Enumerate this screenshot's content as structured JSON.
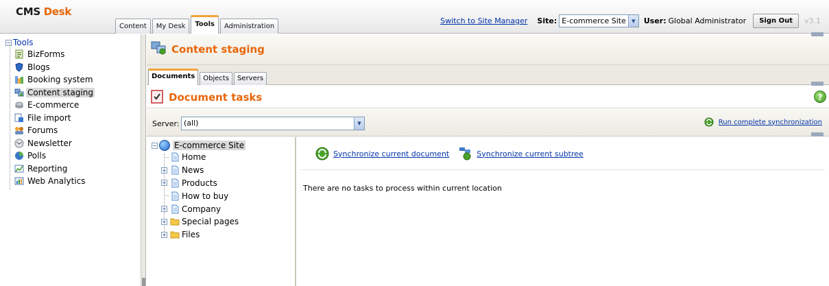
{
  "header": {
    "brand_cms": "CMS",
    "brand_desk": "Desk",
    "tabs": [
      {
        "label": "Content",
        "active": false
      },
      {
        "label": "My Desk",
        "active": false
      },
      {
        "label": "Tools",
        "active": true
      },
      {
        "label": "Administration",
        "active": false
      }
    ],
    "switch_link": "Switch to Site Manager",
    "site_label": "Site:",
    "site_value": "E-commerce Site",
    "user_label": "User:",
    "user_name": "Global Administrator",
    "sign_out": "Sign Out",
    "version": "v3.1"
  },
  "sidebar": {
    "root": "Tools",
    "items": [
      {
        "label": "BizForms",
        "icon": "bizforms-icon",
        "selected": false
      },
      {
        "label": "Blogs",
        "icon": "blogs-icon",
        "selected": false
      },
      {
        "label": "Booking system",
        "icon": "booking-icon",
        "selected": false
      },
      {
        "label": "Content staging",
        "icon": "staging-icon",
        "selected": true
      },
      {
        "label": "E-commerce",
        "icon": "ecommerce-icon",
        "selected": false
      },
      {
        "label": "File import",
        "icon": "file-import-icon",
        "selected": false
      },
      {
        "label": "Forums",
        "icon": "forums-icon",
        "selected": false
      },
      {
        "label": "Newsletter",
        "icon": "newsletter-icon",
        "selected": false
      },
      {
        "label": "Polls",
        "icon": "polls-icon",
        "selected": false
      },
      {
        "label": "Reporting",
        "icon": "reporting-icon",
        "selected": false
      },
      {
        "label": "Web Analytics",
        "icon": "analytics-icon",
        "selected": false
      }
    ]
  },
  "main": {
    "title": "Content staging",
    "tabs": [
      {
        "label": "Documents",
        "active": true
      },
      {
        "label": "Objects",
        "active": false
      },
      {
        "label": "Servers",
        "active": false
      }
    ],
    "section_title": "Document tasks",
    "server_label": "Server:",
    "server_value": "(all)",
    "run_sync": "Run complete synchronization",
    "tree": {
      "root": "E-commerce Site",
      "items": [
        {
          "label": "Home",
          "type": "page",
          "expandable": false
        },
        {
          "label": "News",
          "type": "page",
          "expandable": true
        },
        {
          "label": "Products",
          "type": "page",
          "expandable": true
        },
        {
          "label": "How to buy",
          "type": "page",
          "expandable": false
        },
        {
          "label": "Company",
          "type": "page",
          "expandable": true
        },
        {
          "label": "Special pages",
          "type": "folder",
          "expandable": true
        },
        {
          "label": "Files",
          "type": "folder",
          "expandable": true
        }
      ]
    },
    "sync_current_document": "Synchronize current document",
    "sync_current_subtree": "Synchronize current subtree",
    "no_tasks": "There are no tasks to process within current location"
  },
  "colors": {
    "accent": "#e8660a",
    "tab_highlight": "#f0a43a",
    "link": "#0033aa"
  }
}
